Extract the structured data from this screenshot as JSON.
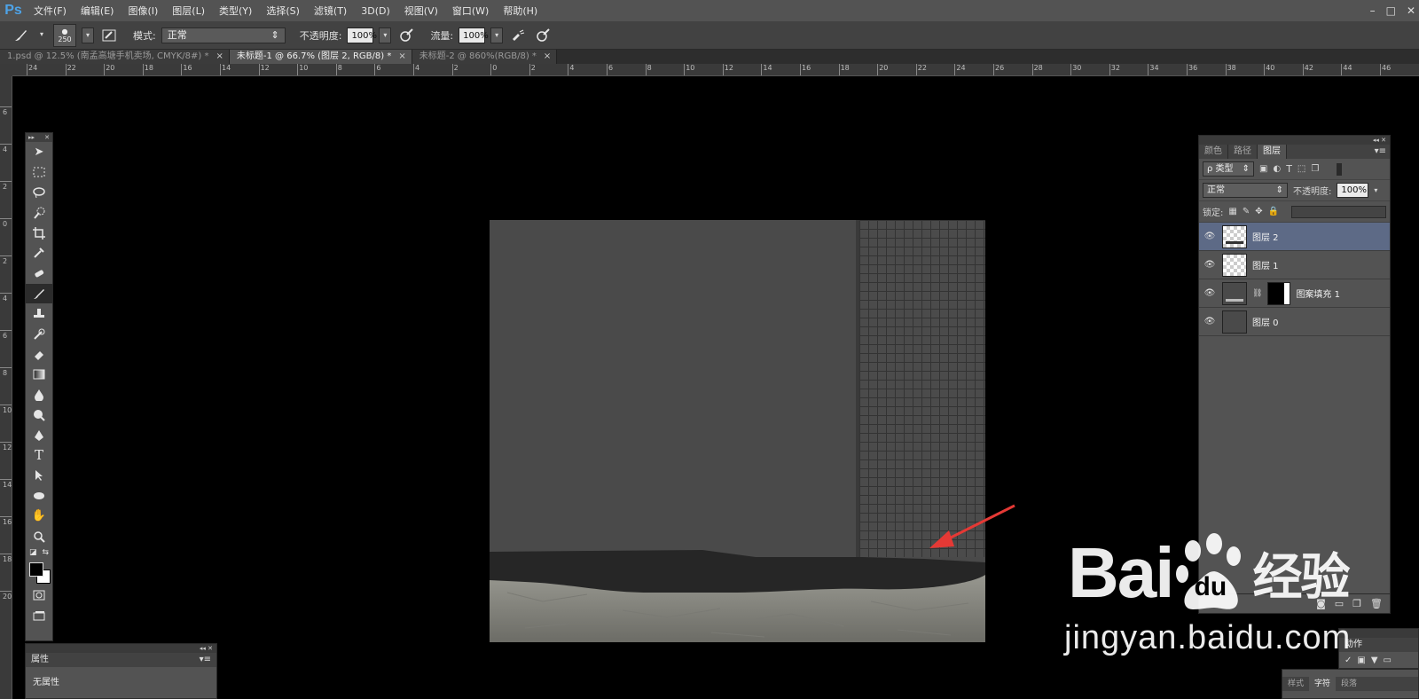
{
  "app": {
    "logo": "Ps"
  },
  "menu": [
    "文件(F)",
    "编辑(E)",
    "图像(I)",
    "图层(L)",
    "类型(Y)",
    "选择(S)",
    "滤镜(T)",
    "3D(D)",
    "视图(V)",
    "窗口(W)",
    "帮助(H)"
  ],
  "window_controls": {
    "minimize": "–",
    "maximize": "□",
    "close": "✕"
  },
  "options": {
    "brush_size": "250",
    "mode_label": "模式:",
    "mode_value": "正常",
    "opacity_label": "不透明度:",
    "opacity_value": "100%",
    "flow_label": "流量:",
    "flow_value": "100%"
  },
  "tabs": [
    {
      "label": "1.psd @ 12.5% (南孟高塘手机卖场, CMYK/8#) *",
      "active": false
    },
    {
      "label": "未标题-1 @ 66.7% (图层 2, RGB/8) *",
      "active": true
    },
    {
      "label": "未标题-2 @ 860%(RGB/8) *",
      "active": false
    }
  ],
  "tab_close": "×",
  "ruler_top_labels": [
    "24",
    "22",
    "20",
    "18",
    "16",
    "14",
    "12",
    "10",
    "8",
    "6",
    "4",
    "2",
    "0",
    "2",
    "4",
    "6",
    "8",
    "10",
    "12",
    "14",
    "16",
    "18",
    "20",
    "22",
    "24",
    "26",
    "28",
    "30",
    "32",
    "34",
    "36",
    "38",
    "40",
    "42",
    "44",
    "46"
  ],
  "ruler_left_labels": [
    "6",
    "4",
    "2",
    "0",
    "2",
    "4",
    "6",
    "8",
    "10",
    "12",
    "14",
    "16",
    "18",
    "20"
  ],
  "layers_panel": {
    "tabs": [
      "颜色",
      "路径",
      "图层"
    ],
    "active_tab": "图层",
    "filter_label": "ρ 类型",
    "blend_mode": "正常",
    "opacity_label": "不透明度:",
    "opacity_value": "100%",
    "lock_label": "锁定:",
    "layers": [
      {
        "name": "图层 2",
        "selected": true,
        "thumb": "transparent"
      },
      {
        "name": "图层 1",
        "selected": false,
        "thumb": "transparent"
      },
      {
        "name": "图案填充 1",
        "selected": false,
        "thumb": "pattern"
      },
      {
        "name": "图层 0",
        "selected": false,
        "thumb": "dark"
      }
    ]
  },
  "properties_panel": {
    "tab": "属性",
    "body": "无属性"
  },
  "actions_panel": {
    "tab": "动作"
  },
  "char_panel": {
    "tabs": [
      "样式",
      "字符",
      "段落"
    ],
    "active_tab": "字符"
  },
  "watermark": {
    "logo_left": "Bai",
    "logo_mid": "du",
    "logo_right": "经验",
    "url": "jingyan.baidu.com"
  },
  "colors": {
    "accent": "#4ea3e7",
    "arrow": "#e53935",
    "selected_layer": "#5d6a86"
  }
}
